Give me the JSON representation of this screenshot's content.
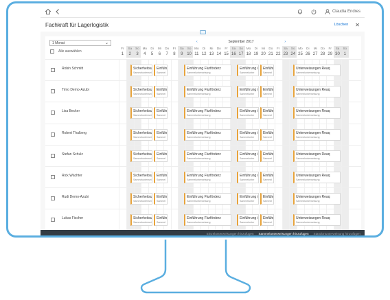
{
  "shell": {
    "user_name": "Claudia Endres"
  },
  "header": {
    "title": "Fachkraft für Lagerlogistik",
    "delete_label": "Löschen"
  },
  "controls": {
    "range_value": "1 Monat",
    "select_all_label": "Alle auswählen",
    "month_title": "September 2017"
  },
  "calendar": {
    "weekdays": [
      "Fr",
      "Sa",
      "So",
      "Mo",
      "Di",
      "Mi",
      "Do",
      "Fr",
      "Sa",
      "So",
      "Mo",
      "Di",
      "Mi",
      "Do",
      "Fr",
      "Sa",
      "So",
      "Mo",
      "Di",
      "Mi",
      "Do",
      "Fr",
      "Sa",
      "So",
      "Mo",
      "Di",
      "Mi",
      "Do",
      "Fr",
      "Sa",
      "So",
      "Mo"
    ],
    "days": [
      "1",
      "2",
      "3",
      "4",
      "5",
      "6",
      "7",
      "8",
      "9",
      "10",
      "11",
      "12",
      "13",
      "14",
      "15",
      "16",
      "17",
      "18",
      "19",
      "20",
      "21",
      "22",
      "23",
      "24",
      "25",
      "26",
      "27",
      "28",
      "29",
      "30",
      "1"
    ]
  },
  "people": [
    {
      "name": "Robin Schmitt"
    },
    {
      "name": "Timo Demo-Azubi"
    },
    {
      "name": "Lisa Becker"
    },
    {
      "name": "Robert Thalberg"
    },
    {
      "name": "Stefan Schulz"
    },
    {
      "name": "Rick Wächter"
    },
    {
      "name": "Rudi Demo-Azubi"
    },
    {
      "name": "Lukas Fischer"
    }
  ],
  "appointments": [
    {
      "title": "Sicherheitsu",
      "sub": "Sammelunterwei"
    },
    {
      "title": "Einführ",
      "sub": "Sammel"
    },
    {
      "title": "Einführung Flurförderz",
      "sub": "Sammelunterweisung"
    },
    {
      "title": "Einführung i",
      "sub": "Sammelunter"
    },
    {
      "title": "Einführ",
      "sub": "Sammel"
    },
    {
      "title": "Unterweisungen Reaq",
      "sub": "Sammelunterweisung"
    }
  ],
  "footer": {
    "btn1": "Einzelunterweisungen hinzufügen",
    "btn2": "Sammelunterweisungen hinzufügen",
    "btn3": "Standortunterweisung hinzufügen"
  },
  "colors": {
    "monitor_frame": "#5aaee0",
    "accent": "#0a6ed1",
    "appointment_marker": "#e8a33a",
    "footer_bg": "#333c44"
  }
}
